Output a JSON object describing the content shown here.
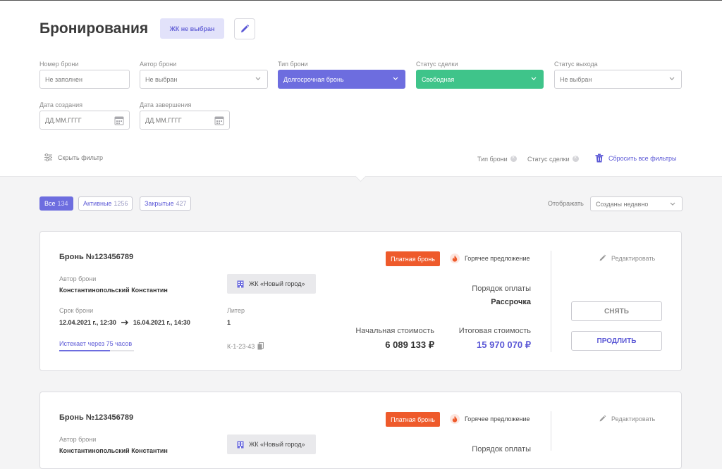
{
  "page": {
    "title": "Бронирования",
    "complex_badge": "ЖК не выбран"
  },
  "filters": {
    "booking_number": {
      "label": "Номер брони",
      "value": "Не заполнен"
    },
    "booking_author": {
      "label": "Автор брони",
      "value": "Не выбран"
    },
    "booking_type": {
      "label": "Тип брони",
      "value": "Долгосрочная бронь"
    },
    "deal_status": {
      "label": "Статус сделки",
      "value": "Свободная"
    },
    "exit_status": {
      "label": "Статус выхода",
      "value": "Не выбран"
    },
    "created_date": {
      "label": "Дата создания",
      "placeholder": "ДД.ММ.ГГГГ"
    },
    "end_date": {
      "label": "Дата завершения",
      "placeholder": "ДД.ММ.ГГГГ"
    },
    "hide_filter": "Скрыть фильтр",
    "active_chips": [
      "Тип брони",
      "Статус сделки"
    ],
    "reset_all": "Сбросить все фильтры"
  },
  "tabs": [
    {
      "label": "Все",
      "count": "134"
    },
    {
      "label": "Активные",
      "count": "1256"
    },
    {
      "label": "Закрытые",
      "count": "427"
    }
  ],
  "display": {
    "label": "Отображать",
    "value": "Созданы недавно"
  },
  "bookings": [
    {
      "title": "Бронь №123456789",
      "author_label": "Автор брони",
      "author": "Константинопольский Константин",
      "term_label": "Срок брони",
      "term_from": "12.04.2021 г., 12:30",
      "term_to": "16.04.2021 г., 14:30",
      "expires": "Истекает через 75 часов",
      "expires_progress": 0.68,
      "complex": "ЖК «Новый город»",
      "liter_label": "Литер",
      "liter": "1",
      "code": "К-1-23-43",
      "paid_badge": "Платная бронь",
      "hot_offer": "Горячее предложение",
      "payment_label": "Порядок оплаты",
      "payment_value": "Рассрочка",
      "initial_label": "Начальная стоимость",
      "initial_value": "6 089 133 ₽",
      "final_label": "Итоговая стоимость",
      "final_value": "15 970 070 ₽",
      "edit": "Редактировать",
      "remove": "СНЯТЬ",
      "extend": "ПРОДЛИТЬ"
    },
    {
      "title": "Бронь №123456789",
      "author_label": "Автор брони",
      "author": "Константинопольский Константин",
      "complex": "ЖК «Новый город»",
      "paid_badge": "Платная бронь",
      "hot_offer": "Горячее предложение",
      "payment_label": "Порядок оплаты",
      "edit": "Редактировать"
    }
  ],
  "colors": {
    "accent": "#6d6ddf",
    "success": "#3fc48a",
    "danger": "#ee5a2b"
  }
}
